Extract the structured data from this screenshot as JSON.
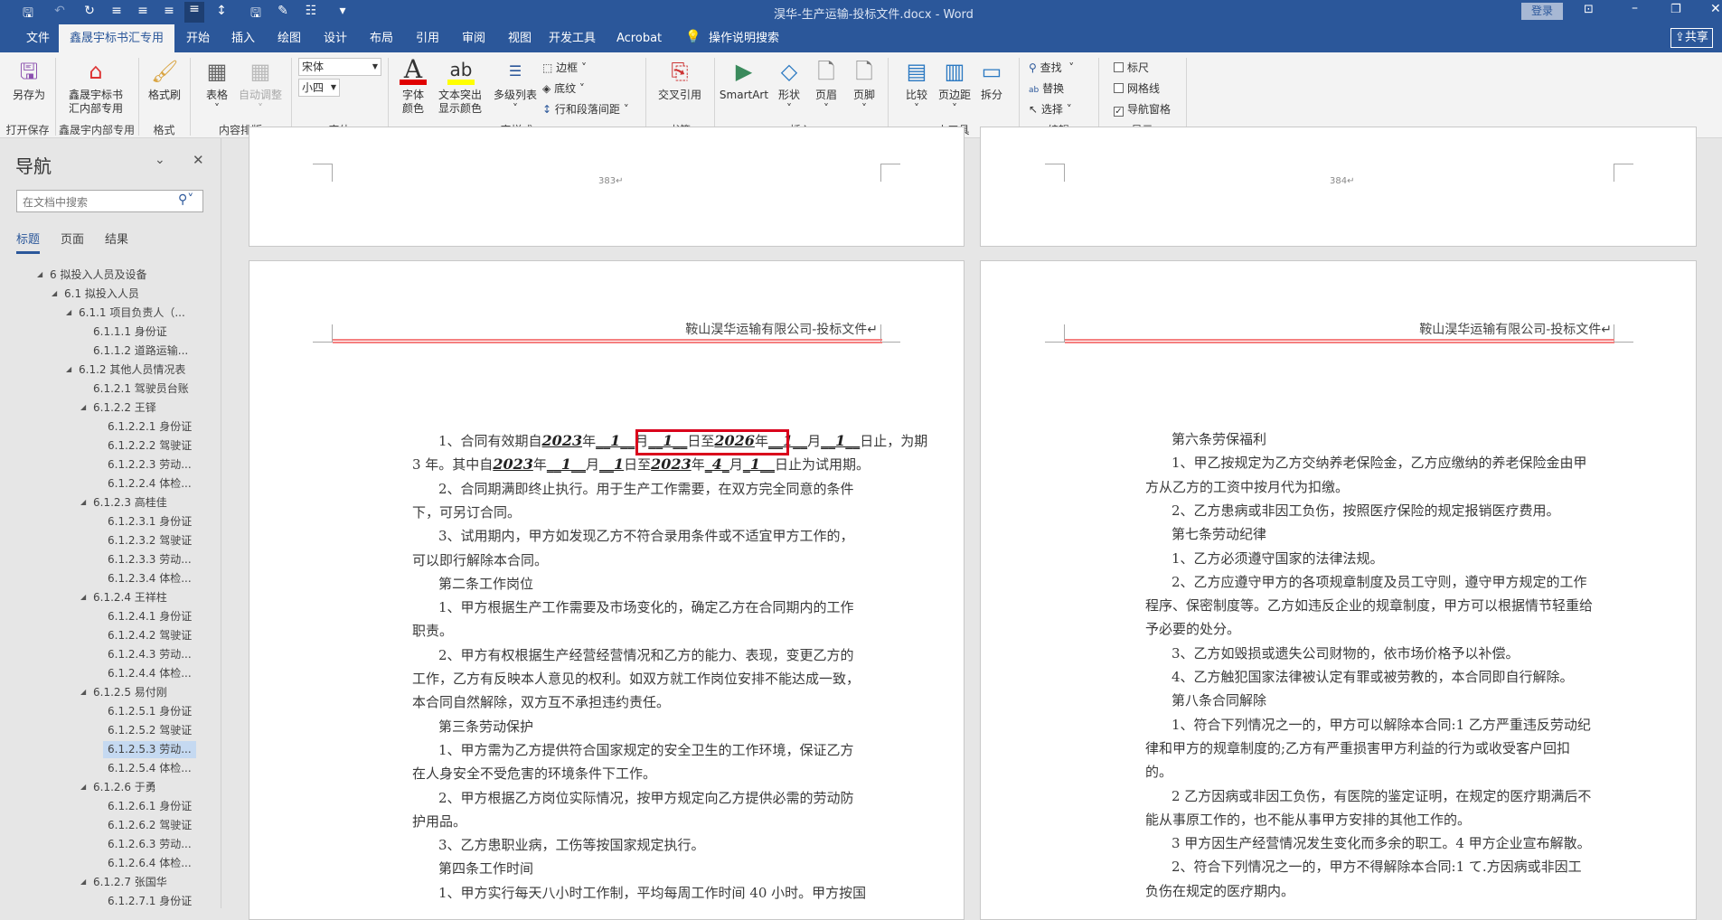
{
  "window": {
    "title": "淏华-生产运输-投标文件.docx  -  Word",
    "login": "登录",
    "share": "共享"
  },
  "tabs": [
    "文件",
    "鑫晟宇标书汇专用",
    "开始",
    "插入",
    "绘图",
    "设计",
    "布局",
    "引用",
    "审阅",
    "视图",
    "开发工具",
    "Acrobat"
  ],
  "tell_me": "操作说明搜索",
  "ribbon": {
    "save_as": "另存为",
    "xsy": "鑫晟宇标书汇内部专用",
    "format_painter": "格式刷",
    "table": "表格",
    "autofit": "自动调整",
    "font_name": "宋体",
    "font_size": "小四",
    "font_color": "字体颜色",
    "highlight": "文本突出显示颜色",
    "multilevel": "多级列表",
    "border": "边框",
    "shading": "底纹",
    "spacing": "行和段落间距",
    "crossref": "交叉引用",
    "smartart": "SmartArt",
    "shapes": "形状",
    "header": "页眉",
    "footer": "页脚",
    "compare": "比较",
    "margins": "页边距",
    "split": "拆分",
    "find": "查找",
    "replace": "替换",
    "select": "选择",
    "ruler": "标尺",
    "gridlines": "网格线",
    "navpane": "导航窗格",
    "groups": [
      "打开保存",
      "鑫晟宇内部专用",
      "格式",
      "内容排版",
      "字体",
      "字样式",
      "书签",
      "插入",
      "小工具",
      "编辑",
      "显示"
    ],
    "colors": {
      "font_color": "#e00000",
      "highlight": "#ffff00"
    }
  },
  "nav": {
    "title": "导航",
    "search_placeholder": "在文档中搜索",
    "tabs": [
      "标题",
      "页面",
      "结果"
    ],
    "items": [
      {
        "t": "6 拟投入人员及设备",
        "l": 0,
        "e": true
      },
      {
        "t": "6.1 拟投入人员",
        "l": 1,
        "e": true
      },
      {
        "t": "6.1.1 项目负责人（...",
        "l": 2,
        "e": true
      },
      {
        "t": "6.1.1.1 身份证",
        "l": 3
      },
      {
        "t": "6.1.1.2 道路运输...",
        "l": 3
      },
      {
        "t": "6.1.2 其他人员情况表",
        "l": 2,
        "e": true
      },
      {
        "t": "6.1.2.1 驾驶员台账",
        "l": 3
      },
      {
        "t": "6.1.2.2 王铎",
        "l": 3,
        "e": true
      },
      {
        "t": "6.1.2.2.1 身份证",
        "l": 4
      },
      {
        "t": "6.1.2.2.2 驾驶证",
        "l": 4
      },
      {
        "t": "6.1.2.2.3 劳动...",
        "l": 4
      },
      {
        "t": "6.1.2.2.4 体检...",
        "l": 4
      },
      {
        "t": "6.1.2.3 高桂佳",
        "l": 3,
        "e": true
      },
      {
        "t": "6.1.2.3.1 身份证",
        "l": 4
      },
      {
        "t": "6.1.2.3.2 驾驶证",
        "l": 4
      },
      {
        "t": "6.1.2.3.3 劳动...",
        "l": 4
      },
      {
        "t": "6.1.2.3.4 体检...",
        "l": 4
      },
      {
        "t": "6.1.2.4 王祥柱",
        "l": 3,
        "e": true
      },
      {
        "t": "6.1.2.4.1 身份证",
        "l": 4
      },
      {
        "t": "6.1.2.4.2 驾驶证",
        "l": 4
      },
      {
        "t": "6.1.2.4.3 劳动...",
        "l": 4
      },
      {
        "t": "6.1.2.4.4 体检...",
        "l": 4
      },
      {
        "t": "6.1.2.5 易付刚",
        "l": 3,
        "e": true
      },
      {
        "t": "6.1.2.5.1 身份证",
        "l": 4
      },
      {
        "t": "6.1.2.5.2 驾驶证",
        "l": 4
      },
      {
        "t": "6.1.2.5.3 劳动...",
        "l": 4,
        "sel": true
      },
      {
        "t": "6.1.2.5.4 体检...",
        "l": 4
      },
      {
        "t": "6.1.2.6 于勇",
        "l": 3,
        "e": true
      },
      {
        "t": "6.1.2.6.1 身份证",
        "l": 4
      },
      {
        "t": "6.1.2.6.2 驾驶证",
        "l": 4
      },
      {
        "t": "6.1.2.6.3 劳动...",
        "l": 4
      },
      {
        "t": "6.1.2.6.4 体检...",
        "l": 4
      },
      {
        "t": "6.1.2.7 张国华",
        "l": 3,
        "e": true
      },
      {
        "t": "6.1.2.7.1 身份证",
        "l": 4
      }
    ]
  },
  "pages": {
    "left_num": "383↵",
    "right_num": "384↵",
    "header": "鞍山淏华运输有限公司-投标文件↵"
  },
  "left_lines": [
    {
      "i": true,
      "f": true,
      "s": [
        "1、合同有效期自",
        {
          "hw": "2023"
        },
        "年",
        {
          "hw": "__1__"
        },
        "月",
        {
          "hw": "__1__"
        },
        "日至",
        {
          "hw": "2026"
        },
        "年",
        {
          "hw": "__1__"
        },
        "月",
        {
          "hw": "__1__"
        },
        "日止，为期"
      ]
    },
    {
      "f": true,
      "s": [
        "3 年。其中自",
        {
          "hw": "2023"
        },
        "年",
        {
          "hw": "__1__"
        },
        "月",
        {
          "hw": "__1"
        },
        "日至",
        {
          "hw": "2023"
        },
        "年",
        {
          "hw": "_4_"
        },
        "月",
        {
          "hw": "_1__"
        },
        "日止为试用期。"
      ]
    },
    {
      "i": true,
      "f": true,
      "s": [
        "2、合同期满即终止执行。用于生产工作需要，在双方完全同意的条件"
      ]
    },
    {
      "s": [
        "下，可另订合同。"
      ]
    },
    {
      "i": true,
      "f": true,
      "s": [
        "3、试用期内，甲方如发现乙方不符合录用条件或不适宜甲方工作的，"
      ]
    },
    {
      "s": [
        "可以即行解除本合同。"
      ]
    },
    {
      "i": true,
      "s": [
        "第二条工作岗位"
      ]
    },
    {
      "i": true,
      "f": true,
      "s": [
        "1、甲方根据生产工作需要及市场变化的，确定乙方在合同期内的工作"
      ]
    },
    {
      "s": [
        "职责。"
      ]
    },
    {
      "i": true,
      "f": true,
      "s": [
        "2、甲方有权根据生产经营经营情况和乙方的能力、表现，变更乙方的"
      ]
    },
    {
      "f": true,
      "s": [
        "工作，乙方有反映本人意见的权利。如双方就工作岗位安排不能达成一致，"
      ]
    },
    {
      "s": [
        "本合同自然解除，双方互不承担违约责任。"
      ]
    },
    {
      "i": true,
      "s": [
        "第三条劳动保护"
      ]
    },
    {
      "i": true,
      "f": true,
      "s": [
        "1、甲方需为乙方提供符合国家规定的安全卫生的工作环境，保证乙方"
      ]
    },
    {
      "s": [
        "在人身安全不受危害的环境条件下工作。"
      ]
    },
    {
      "i": true,
      "f": true,
      "s": [
        "2、甲方根据乙方岗位实际情况，按甲方规定向乙方提供必需的劳动防"
      ]
    },
    {
      "s": [
        "护用品。"
      ]
    },
    {
      "i": true,
      "s": [
        "3、乙方患职业病，工伤等按国家规定执行。"
      ]
    },
    {
      "i": true,
      "s": [
        "第四条工作时间"
      ]
    },
    {
      "i": true,
      "f": true,
      "s": [
        "1、甲方实行每天八小时工作制，平均每周工作时间 40 小时。甲方按国"
      ]
    }
  ],
  "right_lines": [
    {
      "i": true,
      "s": [
        "第六条劳保福利"
      ]
    },
    {
      "i": true,
      "f": true,
      "s": [
        "1、甲乙按规定为乙方交纳养老保险金，乙方应缴纳的养老保险金由甲"
      ]
    },
    {
      "s": [
        "方从乙方的工资中按月代为扣缴。"
      ]
    },
    {
      "i": true,
      "s": [
        "2、乙方患病或非因工负伤，按照医疗保险的规定报销医疗费用。"
      ]
    },
    {
      "i": true,
      "s": [
        "第七条劳动纪律"
      ]
    },
    {
      "i": true,
      "s": [
        "1、乙方必须遵守国家的法律法规。"
      ]
    },
    {
      "i": true,
      "f": true,
      "s": [
        "2、乙方应遵守甲方的各项规章制度及员工守则，遵守甲方规定的工作"
      ]
    },
    {
      "f": true,
      "s": [
        "程序、保密制度等。乙方如违反企业的规章制度，甲方可以根据情节轻重给"
      ]
    },
    {
      "s": [
        "予必要的处分。"
      ]
    },
    {
      "i": true,
      "s": [
        "3、乙方如毁损或遗失公司财物的，依市场价格予以补偿。"
      ]
    },
    {
      "i": true,
      "s": [
        "4、乙方触犯国家法律被认定有罪或被劳教的，本合同即自行解除。"
      ]
    },
    {
      "i": true,
      "s": [
        "第八条合同解除"
      ]
    },
    {
      "i": true,
      "f": true,
      "s": [
        "1、符合下列情况之一的，甲方可以解除本合同:1 乙方严重违反劳动纪"
      ]
    },
    {
      "f": true,
      "s": [
        "律和甲方的规章制度的;乙方有严重损害甲方利益的行为或收受客户回扣"
      ]
    },
    {
      "s": [
        "的。"
      ]
    },
    {
      "i": true,
      "f": true,
      "s": [
        "2 乙方因病或非因工负伤，有医院的鉴定证明，在规定的医疗期满后不"
      ]
    },
    {
      "s": [
        "能从事原工作的，也不能从事甲方安排的其他工作的。"
      ]
    },
    {
      "i": true,
      "f": true,
      "s": [
        "3 甲方因生产经营情况发生变化而多余的职工。4 甲方企业宣布解散。"
      ]
    },
    {
      "i": true,
      "f": true,
      "s": [
        "2、符合下列情况之一的，甲方不得解除本合同:1 て.方因病或非因工"
      ]
    },
    {
      "s": [
        "负伤在规定的医疗期内。"
      ]
    }
  ]
}
